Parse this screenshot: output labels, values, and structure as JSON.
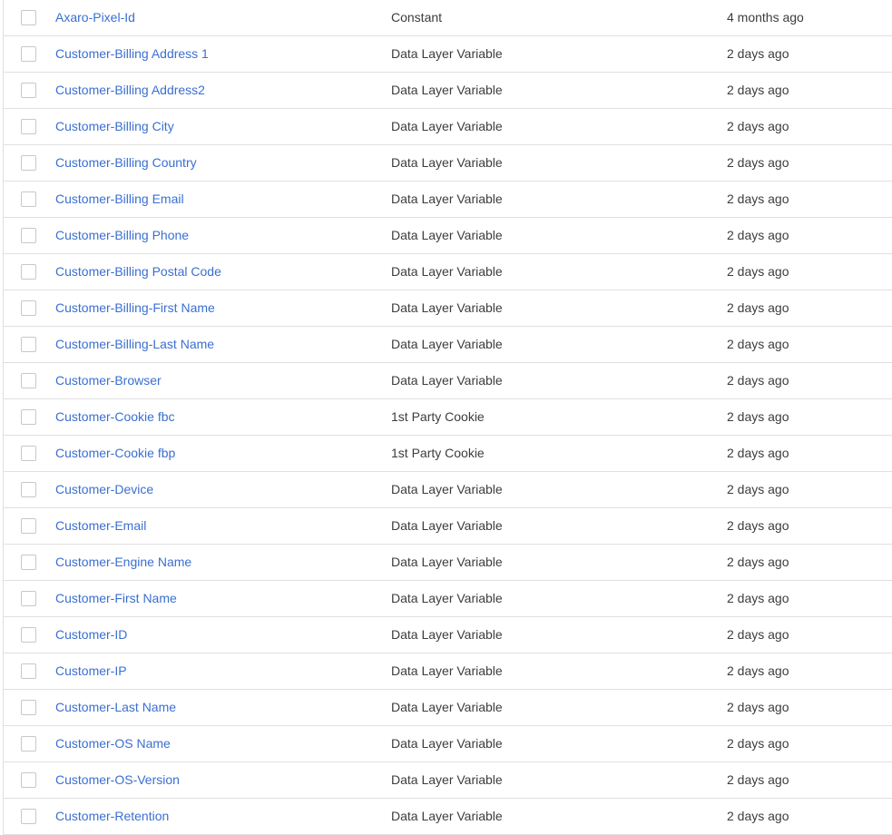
{
  "rows": [
    {
      "name": "Axaro-Pixel-Id",
      "type": "Constant",
      "edited": "4 months ago"
    },
    {
      "name": "Customer-Billing Address 1",
      "type": "Data Layer Variable",
      "edited": "2 days ago"
    },
    {
      "name": "Customer-Billing Address2",
      "type": "Data Layer Variable",
      "edited": "2 days ago"
    },
    {
      "name": "Customer-Billing City",
      "type": "Data Layer Variable",
      "edited": "2 days ago"
    },
    {
      "name": "Customer-Billing Country",
      "type": "Data Layer Variable",
      "edited": "2 days ago"
    },
    {
      "name": "Customer-Billing Email",
      "type": "Data Layer Variable",
      "edited": "2 days ago"
    },
    {
      "name": "Customer-Billing Phone",
      "type": "Data Layer Variable",
      "edited": "2 days ago"
    },
    {
      "name": "Customer-Billing Postal Code",
      "type": "Data Layer Variable",
      "edited": "2 days ago"
    },
    {
      "name": "Customer-Billing-First Name",
      "type": "Data Layer Variable",
      "edited": "2 days ago"
    },
    {
      "name": "Customer-Billing-Last Name",
      "type": "Data Layer Variable",
      "edited": "2 days ago"
    },
    {
      "name": "Customer-Browser",
      "type": "Data Layer Variable",
      "edited": "2 days ago"
    },
    {
      "name": "Customer-Cookie fbc",
      "type": "1st Party Cookie",
      "edited": "2 days ago"
    },
    {
      "name": "Customer-Cookie fbp",
      "type": "1st Party Cookie",
      "edited": "2 days ago"
    },
    {
      "name": "Customer-Device",
      "type": "Data Layer Variable",
      "edited": "2 days ago"
    },
    {
      "name": "Customer-Email",
      "type": "Data Layer Variable",
      "edited": "2 days ago"
    },
    {
      "name": "Customer-Engine Name",
      "type": "Data Layer Variable",
      "edited": "2 days ago"
    },
    {
      "name": "Customer-First Name",
      "type": "Data Layer Variable",
      "edited": "2 days ago"
    },
    {
      "name": "Customer-ID",
      "type": "Data Layer Variable",
      "edited": "2 days ago"
    },
    {
      "name": "Customer-IP",
      "type": "Data Layer Variable",
      "edited": "2 days ago"
    },
    {
      "name": "Customer-Last Name",
      "type": "Data Layer Variable",
      "edited": "2 days ago"
    },
    {
      "name": "Customer-OS Name",
      "type": "Data Layer Variable",
      "edited": "2 days ago"
    },
    {
      "name": "Customer-OS-Version",
      "type": "Data Layer Variable",
      "edited": "2 days ago"
    },
    {
      "name": "Customer-Retention",
      "type": "Data Layer Variable",
      "edited": "2 days ago"
    }
  ]
}
